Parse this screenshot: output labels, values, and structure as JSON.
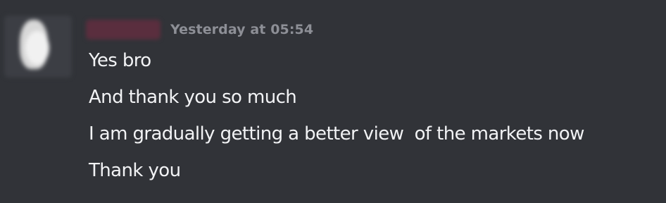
{
  "message": {
    "timestamp": "Yesterday at 05:54",
    "lines": [
      "Yes bro",
      "And thank you so much",
      "I am gradually getting a better view  of the markets now",
      "Thank you"
    ]
  },
  "colors": {
    "background": "#313338",
    "timestamp": "#8d8f96",
    "text": "#f2f3f5"
  }
}
